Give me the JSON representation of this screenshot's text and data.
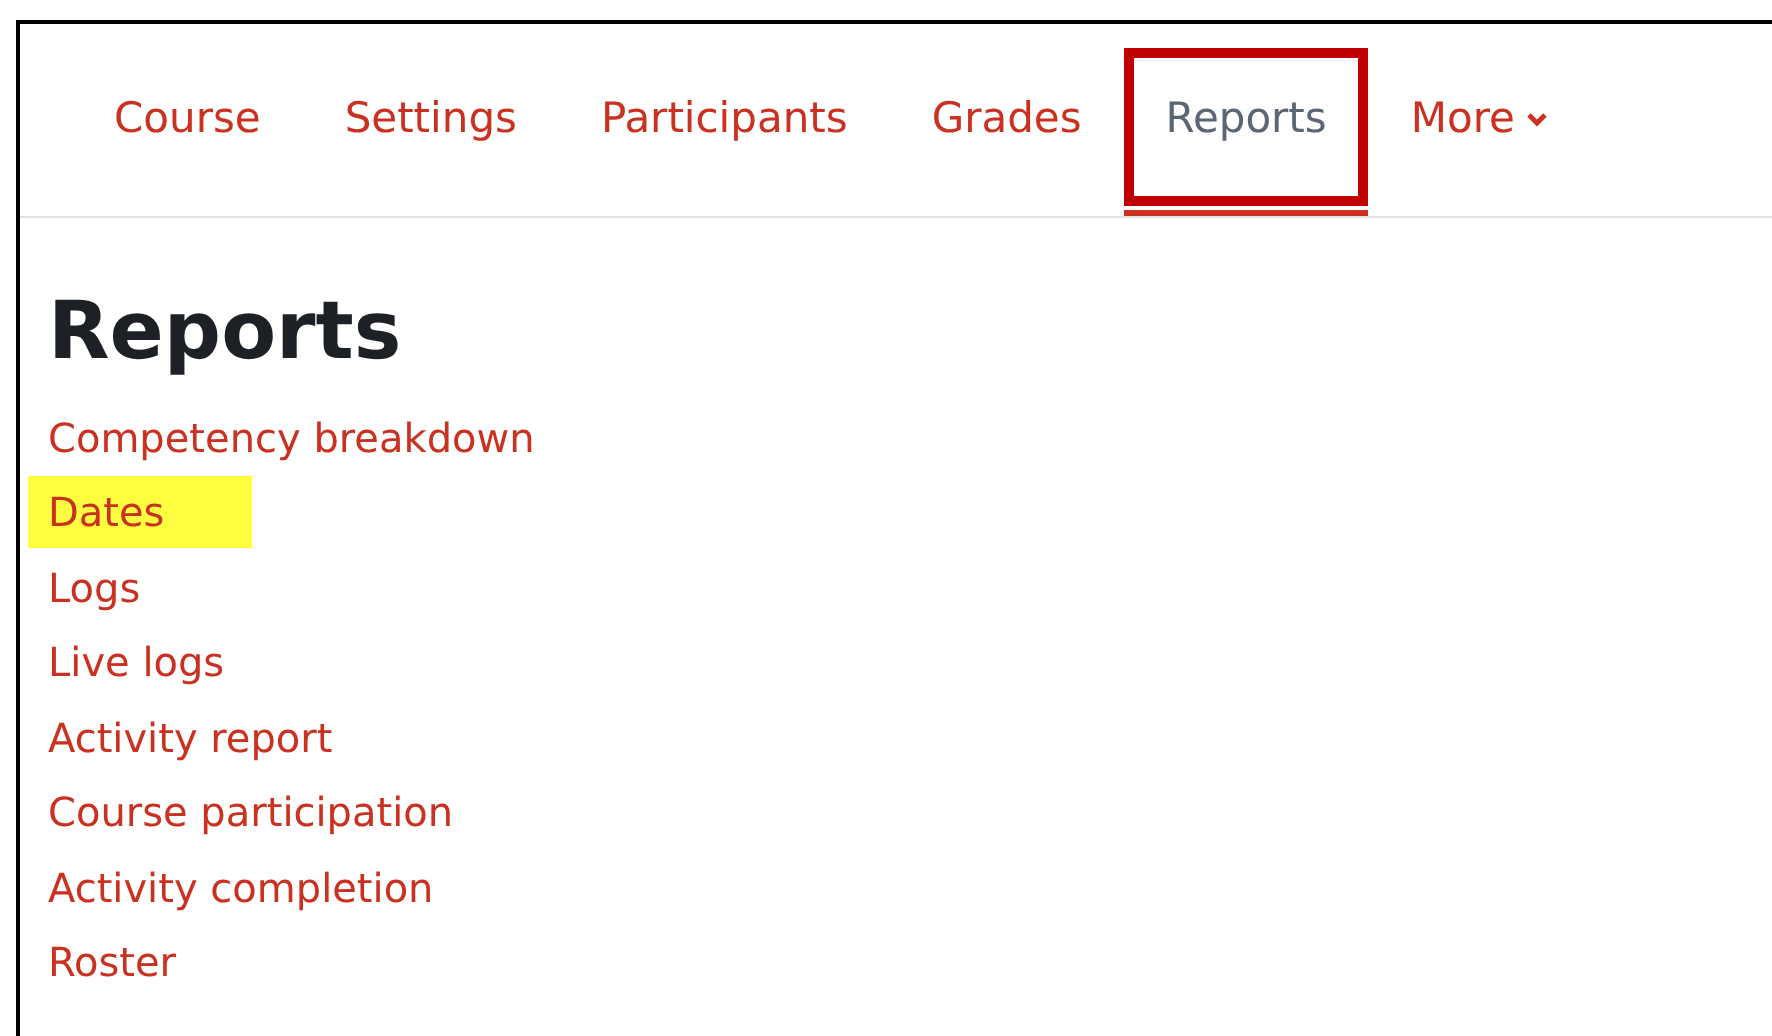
{
  "tabs": [
    {
      "label": "Course",
      "selected": false,
      "annotated": false,
      "kind": "link"
    },
    {
      "label": "Settings",
      "selected": false,
      "annotated": false,
      "kind": "link"
    },
    {
      "label": "Participants",
      "selected": false,
      "annotated": false,
      "kind": "link"
    },
    {
      "label": "Grades",
      "selected": false,
      "annotated": false,
      "kind": "link"
    },
    {
      "label": "Reports",
      "selected": true,
      "annotated": true,
      "kind": "link"
    },
    {
      "label": "More",
      "selected": false,
      "annotated": false,
      "kind": "dropdown"
    }
  ],
  "heading": "Reports",
  "reports": [
    {
      "label": "Competency breakdown",
      "highlighted": false
    },
    {
      "label": "Dates",
      "highlighted": true
    },
    {
      "label": "Logs",
      "highlighted": false
    },
    {
      "label": "Live logs",
      "highlighted": false
    },
    {
      "label": "Activity report",
      "highlighted": false
    },
    {
      "label": "Course participation",
      "highlighted": false
    },
    {
      "label": "Activity completion",
      "highlighted": false
    },
    {
      "label": "Roster",
      "highlighted": false
    }
  ]
}
